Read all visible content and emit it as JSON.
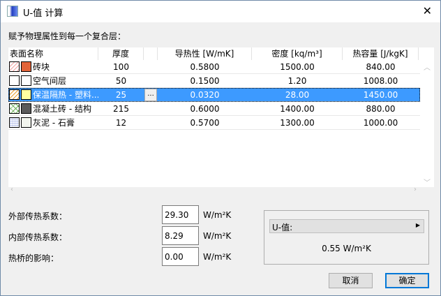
{
  "window": {
    "title": "U-值 计算",
    "close_glyph": "✕"
  },
  "prompt": "赋予物理属性到每一个复合层：",
  "table": {
    "headers": [
      "表面名称",
      "厚度",
      "",
      "导热性 [W/mK]",
      "密度 [kq/m³]",
      "热容量 [J/kgK]"
    ],
    "rows": [
      {
        "name": "砖块",
        "thickness": "100",
        "conductivity": "0.5800",
        "density": "1500.00",
        "heat_capacity": "840.00",
        "hatch_color": "#f2a0a0",
        "fill_color": "#e2643a",
        "hatch": "diag"
      },
      {
        "name": "空气间层",
        "thickness": "50",
        "conductivity": "0.1500",
        "density": "1.20",
        "heat_capacity": "1008.00",
        "hatch_color": "#ffffff",
        "fill_color": "#ffffff",
        "hatch": "none"
      },
      {
        "name": "保温隔热 - 塑料...",
        "thickness": "25",
        "conductivity": "0.0320",
        "density": "28.00",
        "heat_capacity": "1450.00",
        "hatch_color": "#e8a030",
        "fill_color": "#ffffa0",
        "hatch": "diag",
        "selected": true,
        "button": "..."
      },
      {
        "name": "混凝土砖 - 结构",
        "thickness": "215",
        "conductivity": "0.6000",
        "density": "1400.00",
        "heat_capacity": "880.00",
        "hatch_color": "#6cae5a",
        "fill_color": "#5a5a5a",
        "hatch": "cross"
      },
      {
        "name": "灰泥 - 石膏",
        "thickness": "12",
        "conductivity": "0.5700",
        "density": "1300.00",
        "heat_capacity": "1000.00",
        "hatch_color": "#9aa8e0",
        "fill_color": "#f2f5ee",
        "hatch": "dots"
      }
    ]
  },
  "fields": [
    {
      "label": "外部传热系数：",
      "value": "29.30",
      "unit": "W/m²K"
    },
    {
      "label": "内部传热系数：",
      "value": "8.29",
      "unit": "W/m²K"
    },
    {
      "label": "热桥的影响：",
      "value": "0.00",
      "unit": "W/m²K"
    }
  ],
  "result": {
    "header": "U-值:",
    "value": "0.55  W/m²K"
  },
  "buttons": {
    "cancel": "取消",
    "ok": "确定"
  },
  "colors": {
    "selection": "#3d9aff",
    "default_button_border": "#0078d7"
  }
}
